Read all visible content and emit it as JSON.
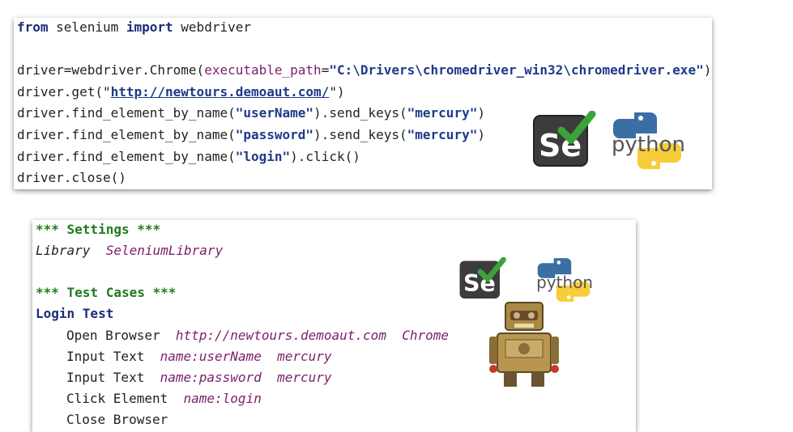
{
  "python_panel": {
    "lines": [
      {
        "a": "from",
        "b": " selenium ",
        "c": "import",
        "d": " webdriver"
      },
      {},
      {
        "a": "driver=webdriver.Chrome(",
        "b": "executable_path",
        "c": "=",
        "d": "\"C:\\Drivers\\chromedriver_win32\\chromedriver.exe\"",
        "e": ")"
      },
      {
        "a": "driver.get(\"",
        "b": "http://newtours.demoaut.com/",
        "c": "\")"
      },
      {
        "a": "driver.find_element_by_name(",
        "b": "\"userName\"",
        "c": ").send_keys(",
        "d": "\"mercury\"",
        "e": ")"
      },
      {
        "a": "driver.find_element_by_name(",
        "b": "\"password\"",
        "c": ").send_keys(",
        "d": "\"mercury\"",
        "e": ")"
      },
      {
        "a": "driver.find_element_by_name(",
        "b": "\"login\"",
        "c": ").click()"
      },
      {
        "a": "driver.close()"
      }
    ]
  },
  "robot_panel": {
    "settings_header": "*** Settings ***",
    "library_kw": "Library",
    "library_val": "SeleniumLibrary",
    "testcases_header": "*** Test Cases ***",
    "testcase_name": "Login Test",
    "steps": [
      {
        "kw": "Open Browser",
        "args": [
          "http://newtours.demoaut.com",
          "Chrome"
        ]
      },
      {
        "kw": "Input Text",
        "args": [
          "name:userName",
          "mercury"
        ]
      },
      {
        "kw": "Input Text",
        "args": [
          "name:password",
          "mercury"
        ]
      },
      {
        "kw": "Click Element",
        "args": [
          "name:login"
        ]
      },
      {
        "kw": "Close Browser",
        "args": []
      }
    ]
  },
  "logos": {
    "selenium_text": "Se",
    "python_text": "python",
    "selenium_color": "#3c3c3c",
    "check_color": "#3aa43a",
    "python_blue": "#3b6ea5",
    "python_yellow": "#f7cd3a"
  }
}
